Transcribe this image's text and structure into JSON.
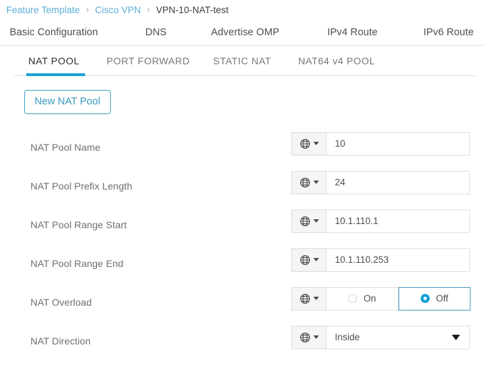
{
  "breadcrumb": {
    "items": [
      {
        "label": "Feature Template",
        "type": "link"
      },
      {
        "label": "Cisco VPN",
        "type": "link"
      },
      {
        "label": "VPN-10-NAT-test",
        "type": "current"
      }
    ],
    "separator": "›"
  },
  "primary_tabs": [
    {
      "label": "Basic Configuration",
      "active": false
    },
    {
      "label": "DNS",
      "active": false
    },
    {
      "label": "Advertise OMP",
      "active": false
    },
    {
      "label": "IPv4 Route",
      "active": false
    },
    {
      "label": "IPv6 Route",
      "active": false
    }
  ],
  "sub_tabs": [
    {
      "label": "NAT POOL",
      "active": true
    },
    {
      "label": "PORT FORWARD",
      "active": false
    },
    {
      "label": "STATIC NAT",
      "active": false
    },
    {
      "label": "NAT64 v4 POOL",
      "active": false
    }
  ],
  "toolbar": {
    "new_pool_label": "New NAT Pool"
  },
  "form": {
    "scope_icon": "globe-icon",
    "fields": [
      {
        "label": "NAT Pool Name",
        "type": "text",
        "value": "10",
        "placeholder": ""
      },
      {
        "label": "NAT Pool Prefix Length",
        "type": "text",
        "value": "24",
        "placeholder": ""
      },
      {
        "label": "NAT Pool Range Start",
        "type": "text",
        "value": "10.1.110.1",
        "placeholder": ""
      },
      {
        "label": "NAT Pool Range End",
        "type": "text",
        "value": "10.1.110.253",
        "placeholder": ""
      },
      {
        "label": "NAT Overload",
        "type": "radio",
        "options": [
          {
            "label": "On",
            "selected": false
          },
          {
            "label": "Off",
            "selected": true
          }
        ]
      },
      {
        "label": "NAT Direction",
        "type": "select",
        "value": "Inside"
      }
    ]
  },
  "colors": {
    "accent": "#1ba0d7",
    "link": "#5badd8",
    "button_border": "#3aa5c4",
    "button_text": "#3698bb",
    "radio_selected": "#0e9fdb",
    "radio_selected_border": "#4a9cc4"
  }
}
